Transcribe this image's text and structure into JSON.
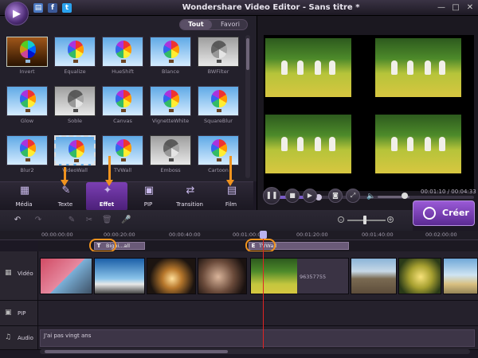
{
  "titlebar": {
    "title": "Wondershare Video Editor - Sans titre *",
    "quick_icons": [
      "save-icon",
      "facebook-icon",
      "twitter-icon"
    ]
  },
  "library": {
    "filter_tabs": [
      "Tout",
      "Favori"
    ],
    "selected_filter": "Tout",
    "effects": [
      {
        "label": "Invert"
      },
      {
        "label": "Equalize"
      },
      {
        "label": "HueShift"
      },
      {
        "label": "Blance"
      },
      {
        "label": "BWFilter"
      },
      {
        "label": "Glow"
      },
      {
        "label": "Soble"
      },
      {
        "label": "Canvas"
      },
      {
        "label": "VignetteWhite"
      },
      {
        "label": "SquareBlur"
      },
      {
        "label": "Blur2"
      },
      {
        "label": "VideoWall"
      },
      {
        "label": "TVWall"
      },
      {
        "label": "Emboss"
      },
      {
        "label": "Cartoon"
      }
    ]
  },
  "categories": [
    {
      "label": "Média",
      "icon": "media-icon"
    },
    {
      "label": "Texte",
      "icon": "text-icon"
    },
    {
      "label": "Effet",
      "icon": "effect-icon",
      "active": true
    },
    {
      "label": "PIP",
      "icon": "pip-icon"
    },
    {
      "label": "Transition",
      "icon": "transition-icon"
    },
    {
      "label": "Film",
      "icon": "film-icon"
    }
  ],
  "preview": {
    "time": "00:01:10 / 00:04:33",
    "progress": 0.26,
    "volume": 0.8
  },
  "create_label": "Créer",
  "timeline": {
    "ruler_ticks": [
      "00:00:00:00",
      "00:00:20:00",
      "00:00:40:00",
      "00:01:00:00",
      "00:01:20:00",
      "00:01:40:00",
      "00:02:00:00"
    ],
    "tracks": {
      "video": "Vidéo",
      "pip": "PIP",
      "audio": "Audio"
    },
    "text_clips": [
      {
        "badge": "T",
        "label": "Bigni...all"
      },
      {
        "badge": "E",
        "label": "TVWall"
      }
    ],
    "clip_annotation": "96357755",
    "audio_clip_label": "J'ai pas vingt ans"
  },
  "colors": {
    "accent": "#7b3fb3",
    "highlight": "#f0931e",
    "playhead": "#e02424"
  }
}
